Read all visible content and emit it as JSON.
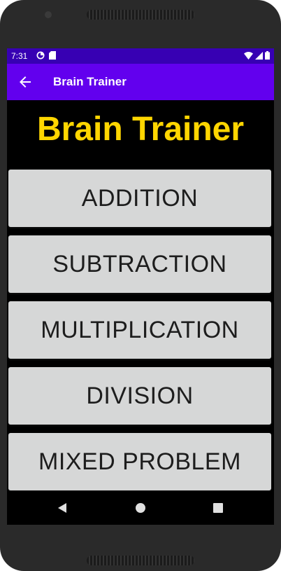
{
  "status_bar": {
    "time": "7:31",
    "left_icons": [
      "data-saver-icon",
      "sd-card-icon"
    ],
    "right_icons": [
      "wifi-icon",
      "signal-icon",
      "battery-icon"
    ]
  },
  "app_bar": {
    "title": "Brain Trainer",
    "back_icon": "arrow-left-icon"
  },
  "main": {
    "heading": "Brain Trainer",
    "buttons": [
      {
        "label": "ADDITION"
      },
      {
        "label": "SUBTRACTION"
      },
      {
        "label": "MULTIPLICATION"
      },
      {
        "label": "DIVISION"
      },
      {
        "label": "MIXED PROBLEM"
      }
    ]
  },
  "nav_bar": {
    "icons": [
      "nav-back-icon",
      "nav-home-icon",
      "nav-recents-icon"
    ]
  },
  "colors": {
    "status_bar": "#3700b3",
    "app_bar": "#6200ee",
    "heading": "#ffd600",
    "button_bg": "#d6d7d7",
    "screen_bg": "#000000"
  }
}
